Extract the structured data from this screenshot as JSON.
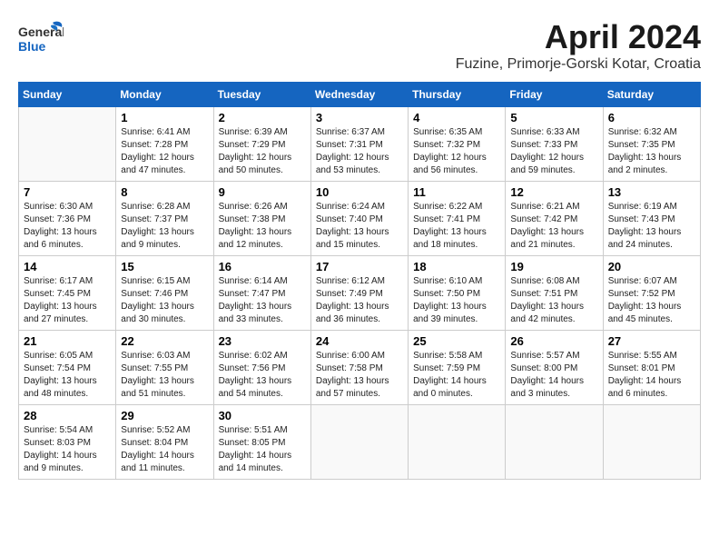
{
  "header": {
    "logo_general": "General",
    "logo_blue": "Blue",
    "month": "April 2024",
    "location": "Fuzine, Primorje-Gorski Kotar, Croatia"
  },
  "weekdays": [
    "Sunday",
    "Monday",
    "Tuesday",
    "Wednesday",
    "Thursday",
    "Friday",
    "Saturday"
  ],
  "weeks": [
    [
      {
        "day": "",
        "sunrise": "",
        "sunset": "",
        "daylight": ""
      },
      {
        "day": "1",
        "sunrise": "Sunrise: 6:41 AM",
        "sunset": "Sunset: 7:28 PM",
        "daylight": "Daylight: 12 hours and 47 minutes."
      },
      {
        "day": "2",
        "sunrise": "Sunrise: 6:39 AM",
        "sunset": "Sunset: 7:29 PM",
        "daylight": "Daylight: 12 hours and 50 minutes."
      },
      {
        "day": "3",
        "sunrise": "Sunrise: 6:37 AM",
        "sunset": "Sunset: 7:31 PM",
        "daylight": "Daylight: 12 hours and 53 minutes."
      },
      {
        "day": "4",
        "sunrise": "Sunrise: 6:35 AM",
        "sunset": "Sunset: 7:32 PM",
        "daylight": "Daylight: 12 hours and 56 minutes."
      },
      {
        "day": "5",
        "sunrise": "Sunrise: 6:33 AM",
        "sunset": "Sunset: 7:33 PM",
        "daylight": "Daylight: 12 hours and 59 minutes."
      },
      {
        "day": "6",
        "sunrise": "Sunrise: 6:32 AM",
        "sunset": "Sunset: 7:35 PM",
        "daylight": "Daylight: 13 hours and 2 minutes."
      }
    ],
    [
      {
        "day": "7",
        "sunrise": "Sunrise: 6:30 AM",
        "sunset": "Sunset: 7:36 PM",
        "daylight": "Daylight: 13 hours and 6 minutes."
      },
      {
        "day": "8",
        "sunrise": "Sunrise: 6:28 AM",
        "sunset": "Sunset: 7:37 PM",
        "daylight": "Daylight: 13 hours and 9 minutes."
      },
      {
        "day": "9",
        "sunrise": "Sunrise: 6:26 AM",
        "sunset": "Sunset: 7:38 PM",
        "daylight": "Daylight: 13 hours and 12 minutes."
      },
      {
        "day": "10",
        "sunrise": "Sunrise: 6:24 AM",
        "sunset": "Sunset: 7:40 PM",
        "daylight": "Daylight: 13 hours and 15 minutes."
      },
      {
        "day": "11",
        "sunrise": "Sunrise: 6:22 AM",
        "sunset": "Sunset: 7:41 PM",
        "daylight": "Daylight: 13 hours and 18 minutes."
      },
      {
        "day": "12",
        "sunrise": "Sunrise: 6:21 AM",
        "sunset": "Sunset: 7:42 PM",
        "daylight": "Daylight: 13 hours and 21 minutes."
      },
      {
        "day": "13",
        "sunrise": "Sunrise: 6:19 AM",
        "sunset": "Sunset: 7:43 PM",
        "daylight": "Daylight: 13 hours and 24 minutes."
      }
    ],
    [
      {
        "day": "14",
        "sunrise": "Sunrise: 6:17 AM",
        "sunset": "Sunset: 7:45 PM",
        "daylight": "Daylight: 13 hours and 27 minutes."
      },
      {
        "day": "15",
        "sunrise": "Sunrise: 6:15 AM",
        "sunset": "Sunset: 7:46 PM",
        "daylight": "Daylight: 13 hours and 30 minutes."
      },
      {
        "day": "16",
        "sunrise": "Sunrise: 6:14 AM",
        "sunset": "Sunset: 7:47 PM",
        "daylight": "Daylight: 13 hours and 33 minutes."
      },
      {
        "day": "17",
        "sunrise": "Sunrise: 6:12 AM",
        "sunset": "Sunset: 7:49 PM",
        "daylight": "Daylight: 13 hours and 36 minutes."
      },
      {
        "day": "18",
        "sunrise": "Sunrise: 6:10 AM",
        "sunset": "Sunset: 7:50 PM",
        "daylight": "Daylight: 13 hours and 39 minutes."
      },
      {
        "day": "19",
        "sunrise": "Sunrise: 6:08 AM",
        "sunset": "Sunset: 7:51 PM",
        "daylight": "Daylight: 13 hours and 42 minutes."
      },
      {
        "day": "20",
        "sunrise": "Sunrise: 6:07 AM",
        "sunset": "Sunset: 7:52 PM",
        "daylight": "Daylight: 13 hours and 45 minutes."
      }
    ],
    [
      {
        "day": "21",
        "sunrise": "Sunrise: 6:05 AM",
        "sunset": "Sunset: 7:54 PM",
        "daylight": "Daylight: 13 hours and 48 minutes."
      },
      {
        "day": "22",
        "sunrise": "Sunrise: 6:03 AM",
        "sunset": "Sunset: 7:55 PM",
        "daylight": "Daylight: 13 hours and 51 minutes."
      },
      {
        "day": "23",
        "sunrise": "Sunrise: 6:02 AM",
        "sunset": "Sunset: 7:56 PM",
        "daylight": "Daylight: 13 hours and 54 minutes."
      },
      {
        "day": "24",
        "sunrise": "Sunrise: 6:00 AM",
        "sunset": "Sunset: 7:58 PM",
        "daylight": "Daylight: 13 hours and 57 minutes."
      },
      {
        "day": "25",
        "sunrise": "Sunrise: 5:58 AM",
        "sunset": "Sunset: 7:59 PM",
        "daylight": "Daylight: 14 hours and 0 minutes."
      },
      {
        "day": "26",
        "sunrise": "Sunrise: 5:57 AM",
        "sunset": "Sunset: 8:00 PM",
        "daylight": "Daylight: 14 hours and 3 minutes."
      },
      {
        "day": "27",
        "sunrise": "Sunrise: 5:55 AM",
        "sunset": "Sunset: 8:01 PM",
        "daylight": "Daylight: 14 hours and 6 minutes."
      }
    ],
    [
      {
        "day": "28",
        "sunrise": "Sunrise: 5:54 AM",
        "sunset": "Sunset: 8:03 PM",
        "daylight": "Daylight: 14 hours and 9 minutes."
      },
      {
        "day": "29",
        "sunrise": "Sunrise: 5:52 AM",
        "sunset": "Sunset: 8:04 PM",
        "daylight": "Daylight: 14 hours and 11 minutes."
      },
      {
        "day": "30",
        "sunrise": "Sunrise: 5:51 AM",
        "sunset": "Sunset: 8:05 PM",
        "daylight": "Daylight: 14 hours and 14 minutes."
      },
      {
        "day": "",
        "sunrise": "",
        "sunset": "",
        "daylight": ""
      },
      {
        "day": "",
        "sunrise": "",
        "sunset": "",
        "daylight": ""
      },
      {
        "day": "",
        "sunrise": "",
        "sunset": "",
        "daylight": ""
      },
      {
        "day": "",
        "sunrise": "",
        "sunset": "",
        "daylight": ""
      }
    ]
  ]
}
